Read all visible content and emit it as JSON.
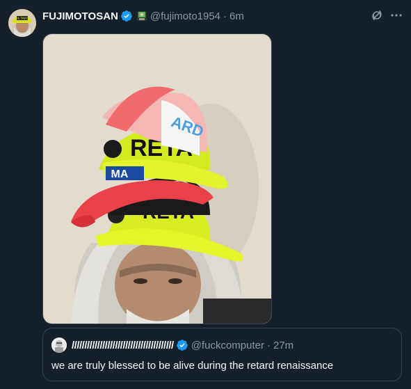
{
  "post": {
    "display_name": "FUJIMOTOSAN",
    "handle": "@fujimoto1954",
    "separator": "·",
    "time": "6m",
    "verified_badge": "verified-badge-icon",
    "affiliate_badge": "computer-emoji-icon",
    "photo": {
      "hat_text_top": "ARD",
      "hat_text_mid": "RETA",
      "hat_text_low": "RETA",
      "hat_text_side": "MA"
    }
  },
  "quote": {
    "display_name": "////////////////////////////////////////",
    "handle": "@fuckcomputer",
    "separator": "·",
    "time": "27m",
    "text": "we are truly blessed to be alive during the retard renaissance"
  },
  "colors": {
    "background": "#15202b",
    "text": "#f7f9f9",
    "secondary": "#8b98a5",
    "border": "#38444d",
    "verified": "#1d9bf0"
  }
}
